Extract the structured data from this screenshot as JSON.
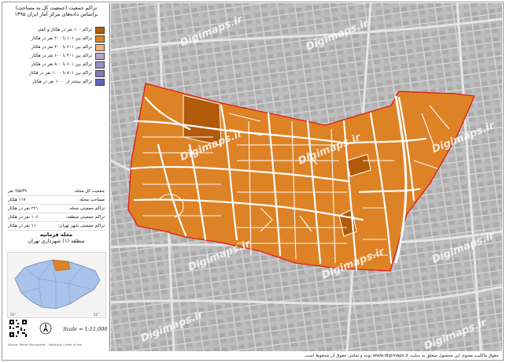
{
  "legend": {
    "title_line1": "تراکم جمعیت (جمعیت کل به مساحت)",
    "title_line2": "براساس داده‌های مرکز آمار ایران ۱۳۹۵",
    "classes": [
      {
        "label": "تراکم ۱۰۰ نفر در هکتار و کمتر",
        "color": "#b05a0a"
      },
      {
        "label": "تراکم بین ۱۰۱ تا ۲۰۰ نفر در هکتار",
        "color": "#de8226"
      },
      {
        "label": "تراکم بین ۲۰۱ تا ۴۰۰ نفر در هکتار",
        "color": "#f0b27a"
      },
      {
        "label": "تراکم بین ۴۰۱ تا ۶۰۰ نفر در هکتار",
        "color": "#b7a2c9"
      },
      {
        "label": "تراکم بین ۶۰۱ تا ۸۰۰ نفر در هکتار",
        "color": "#9a8dc4"
      },
      {
        "label": "تراکم بین ۸۰۱ تا ۱۰۰۰ نفر در هکتار",
        "color": "#7d78bf"
      },
      {
        "label": "تراکم بیشتر از ۱۰۰۰ نفر در هکتار",
        "color": "#5f63b8"
      }
    ]
  },
  "stats": [
    {
      "label": "جمعیت کل محله:",
      "value": "۲۵۸۳۹ نفر"
    },
    {
      "label": "مساحت محله:",
      "value": "۱۱۷ هکتار"
    },
    {
      "label": "تراکم جمعیتی محله:",
      "value": "۲۲۱ نفر در هکتار"
    },
    {
      "label": "تراکم جمعیتی منطقه:",
      "value": "۱۰۶ نفر در هکتار"
    },
    {
      "label": "تراکم جمعیتی شهر تهران:",
      "value": "۱۱۰ نفر در هکتار"
    }
  ],
  "location": {
    "line1": "محله فرمانیه",
    "line2": "منطقه (۱) شهرداری تهران"
  },
  "scale": "Scale = 1:11,000",
  "credit_small": "Source: Tehran Municipality - Statistical Center of Iran",
  "watermark": "Digimaps.ir",
  "footer": "حقوق مالکیت معنوی این محصول متعلق به سایت www.digimaps.ir بوده و تمامی حقوق آن محفوظ است.",
  "colors": {
    "map_bg": "#bdbdbd",
    "roads": "#ffffff",
    "area_main": "#de8226",
    "area_dark": "#b05a0a",
    "boundary": "#e01a1a",
    "locator_fill": "#a9c3ea"
  }
}
